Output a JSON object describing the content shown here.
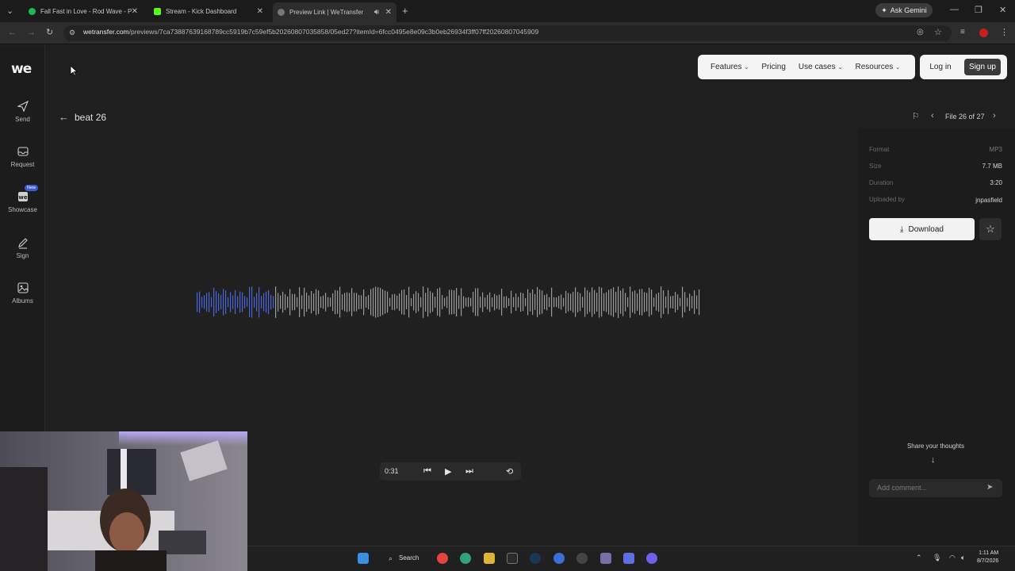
{
  "browser": {
    "tabs": [
      {
        "title": "Fall Fast in Love - Rod Wave - P",
        "favicon_color": "#1db954",
        "active": false
      },
      {
        "title": "Stream - Kick Dashboard",
        "favicon_color": "#53fc18",
        "active": false
      },
      {
        "title": "Preview Link | WeTransfer",
        "favicon_color": "#888888",
        "active": true
      }
    ],
    "gemini_label": "Ask Gemini",
    "url_host": "wetransfer.com",
    "url_path": "/previews/7ca73887639168789cc5919b7c59ef5b20260807035858/05ed27?itemId=6fcc0495e8e09c3b0eb26934f3ff07ff20260807045909"
  },
  "sidenav": {
    "logo": "we",
    "items": [
      {
        "label": "Send",
        "icon": "send-icon"
      },
      {
        "label": "Request",
        "icon": "inbox-icon"
      },
      {
        "label": "Showcase",
        "icon": "showcase-icon",
        "badge": "New"
      },
      {
        "label": "Sign",
        "icon": "pen-icon"
      },
      {
        "label": "Albums",
        "icon": "image-icon"
      }
    ]
  },
  "topmenu": {
    "items": [
      {
        "label": "Features",
        "dropdown": true
      },
      {
        "label": "Pricing",
        "dropdown": false
      },
      {
        "label": "Use cases",
        "dropdown": true
      },
      {
        "label": "Resources",
        "dropdown": true
      }
    ],
    "login": "Log in",
    "signup": "Sign up"
  },
  "file": {
    "title": "beat 26",
    "pager": "File 26 of 27",
    "meta": [
      {
        "key": "Format",
        "value": "MP3"
      },
      {
        "key": "Size",
        "value": "7.7 MB"
      },
      {
        "key": "Duration",
        "value": "3:20"
      },
      {
        "key": "Uploaded by",
        "value": "jnpasfield"
      }
    ],
    "download_label": "Download",
    "share_label": "Share your thoughts",
    "comment_placeholder": "Add comment..."
  },
  "player": {
    "current_time": "0:31",
    "duration_seconds": 200,
    "elapsed_seconds": 31,
    "played_color": "#4a63d8",
    "unplayed_color": "#9a9a9a"
  },
  "taskbar": {
    "search_label": "Search",
    "time": "1:11 AM",
    "date": "8/7/2026"
  },
  "colors": {
    "background": "#1f1f1f",
    "accent": "#3a5bd9"
  }
}
